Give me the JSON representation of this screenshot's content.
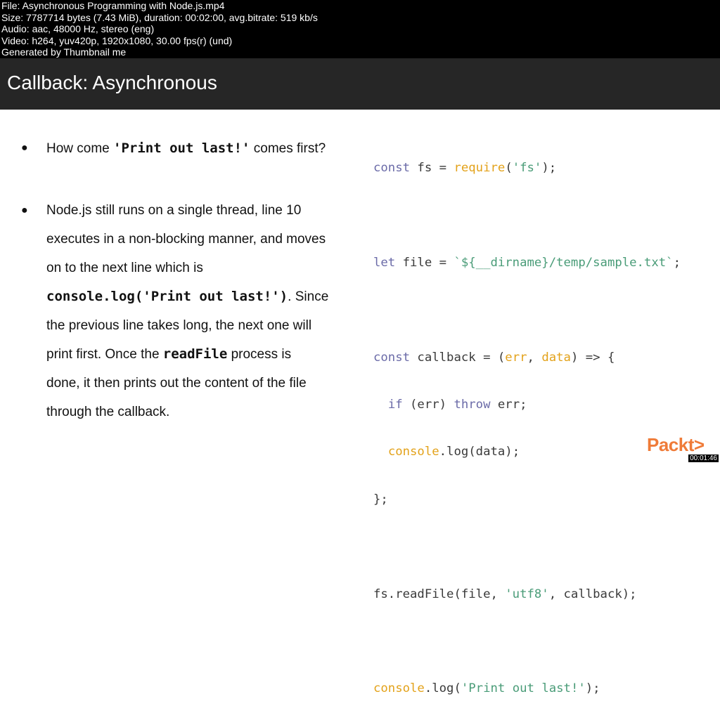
{
  "meta": {
    "lines": [
      "File: Asynchronous Programming with Node.js.mp4",
      "Size: 7787714 bytes (7.43 MiB), duration: 00:02:00, avg.bitrate: 519 kb/s",
      "Audio: aac, 48000 Hz, stereo (eng)",
      "Video: h264, yuv420p, 1920x1080, 30.00 fps(r) (und)",
      "Generated by Thumbnail me"
    ]
  },
  "slide": {
    "title": "Callback: Asynchronous",
    "bullet1": {
      "pre": "How come ",
      "code": "'Print out last!'",
      "post": " comes first?"
    },
    "bullet2": {
      "line1": "Node.js still runs on a single thread, line 10",
      "line2": "executes in a non-blocking manner, and moves",
      "line3": "on to the next line which is",
      "code1": "console.log('Print out last!')",
      "post1": ". Since",
      "line5": "the previous line takes long, the next one will",
      "pre6": "print first. Once the ",
      "code2": "readFile",
      "post6": " process is",
      "line7": "done, it then prints out the content of the file",
      "line8": "through the callback."
    },
    "code": {
      "l1": [
        "const",
        " fs = ",
        "require",
        "(",
        "'fs'",
        ");"
      ],
      "l3": [
        "let",
        " file = ",
        "`${__dirname}/temp/sample.txt`",
        ";"
      ],
      "l5": [
        "const",
        " callback = (",
        "err",
        ", ",
        "data",
        ") => {"
      ],
      "l6": [
        "  ",
        "if",
        " (err) ",
        "throw",
        " err;"
      ],
      "l7": [
        "  ",
        "console",
        ".log(data);"
      ],
      "l8": [
        "};"
      ],
      "l10": [
        "fs.readFile(file, ",
        "'utf8'",
        ", callback);"
      ],
      "l12": [
        "console",
        ".log(",
        "'Print out last!'",
        ");"
      ]
    }
  },
  "logo": "Packt>",
  "timer": "00:01:46",
  "colors": {
    "keyword": "#6b6ba8",
    "function": "#e3a21a",
    "string": "#4a9c78",
    "brand": "#ef7b38"
  }
}
